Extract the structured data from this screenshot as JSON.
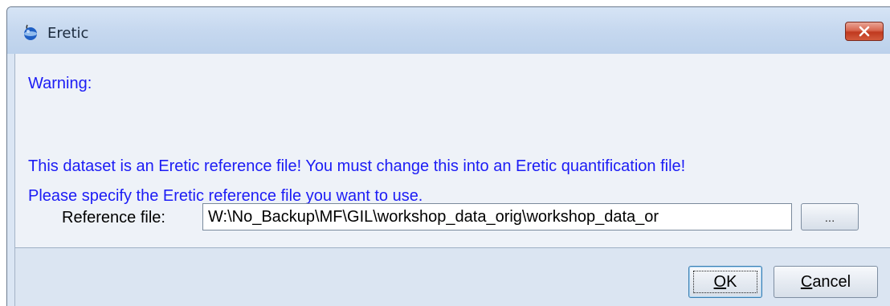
{
  "window": {
    "title": "Eretic"
  },
  "message": {
    "warning": "Warning:",
    "line1": "This dataset is an Eretic reference file! You must change this into an Eretic quantification file!",
    "line2": "Please specify the Eretic reference file you want to use."
  },
  "reference": {
    "label": "Reference file:",
    "value": "W:\\No_Backup\\MF\\GIL\\workshop_data_orig\\workshop_data_or",
    "browse_label": "..."
  },
  "buttons": {
    "ok_mnemonic": "O",
    "ok_rest": "K",
    "cancel_mnemonic": "C",
    "cancel_rest": "ancel"
  },
  "colors": {
    "message_text": "#1c1cf5",
    "close_button": "#c0391f",
    "titlebar": "#c6d8ef"
  },
  "icons": {
    "app": "eretic-app-icon",
    "close": "close-icon"
  }
}
